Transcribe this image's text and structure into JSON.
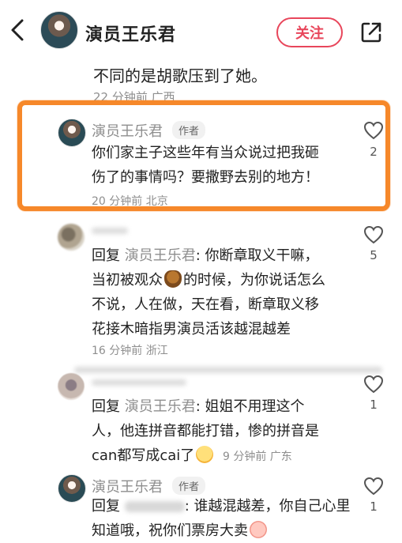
{
  "header": {
    "back_icon": "back-arrow-icon",
    "user_name": "演员王乐君",
    "follow_label": "关注",
    "share_icon": "share-icon"
  },
  "previous_comment": {
    "text": "不同的是胡歌压到了她。",
    "meta": "22 分钟前 广西"
  },
  "comments": [
    {
      "name": "演员王乐君",
      "tag": "作者",
      "lines": [
        "你们家主子这些年有当众说过把我砸",
        "伤了的事情吗？要撒野去别的地方！"
      ],
      "meta": "20 分钟前 北京",
      "likes": "2"
    },
    {
      "name": "",
      "reply_prefix": "回复",
      "reply_to": "演员王乐君",
      "line1_rest": ": 你断章取义干嘛，",
      "line2_a": "当初被观众",
      "line2_b": "的时候，为你说话怎么",
      "line3": "不说，人在做，天在看，断章取义移",
      "line4": "花接木暗指男演员活该越混越差",
      "meta": "16 分钟前 浙江",
      "likes": "5"
    },
    {
      "name": "",
      "reply_prefix": "回复",
      "reply_to": "演员王乐君",
      "line1_rest": ": 姐姐不用理这个",
      "line2": "人，他连拼音都能打错，惨的拼音是",
      "line3_a": "can都写成cai了",
      "meta": "9 分钟前 广东",
      "likes": "1"
    },
    {
      "name": "演员王乐君",
      "tag": "作者",
      "reply_prefix": "回复",
      "line1_rest": ": 谁越混越差，你自己心里",
      "line2_a": "知道哦，祝你们票房大卖",
      "likes": "1"
    }
  ],
  "colors": {
    "accent_red": "#e8465b",
    "highlight_orange": "#f6882a",
    "meta_gray": "#8e8e8e"
  }
}
